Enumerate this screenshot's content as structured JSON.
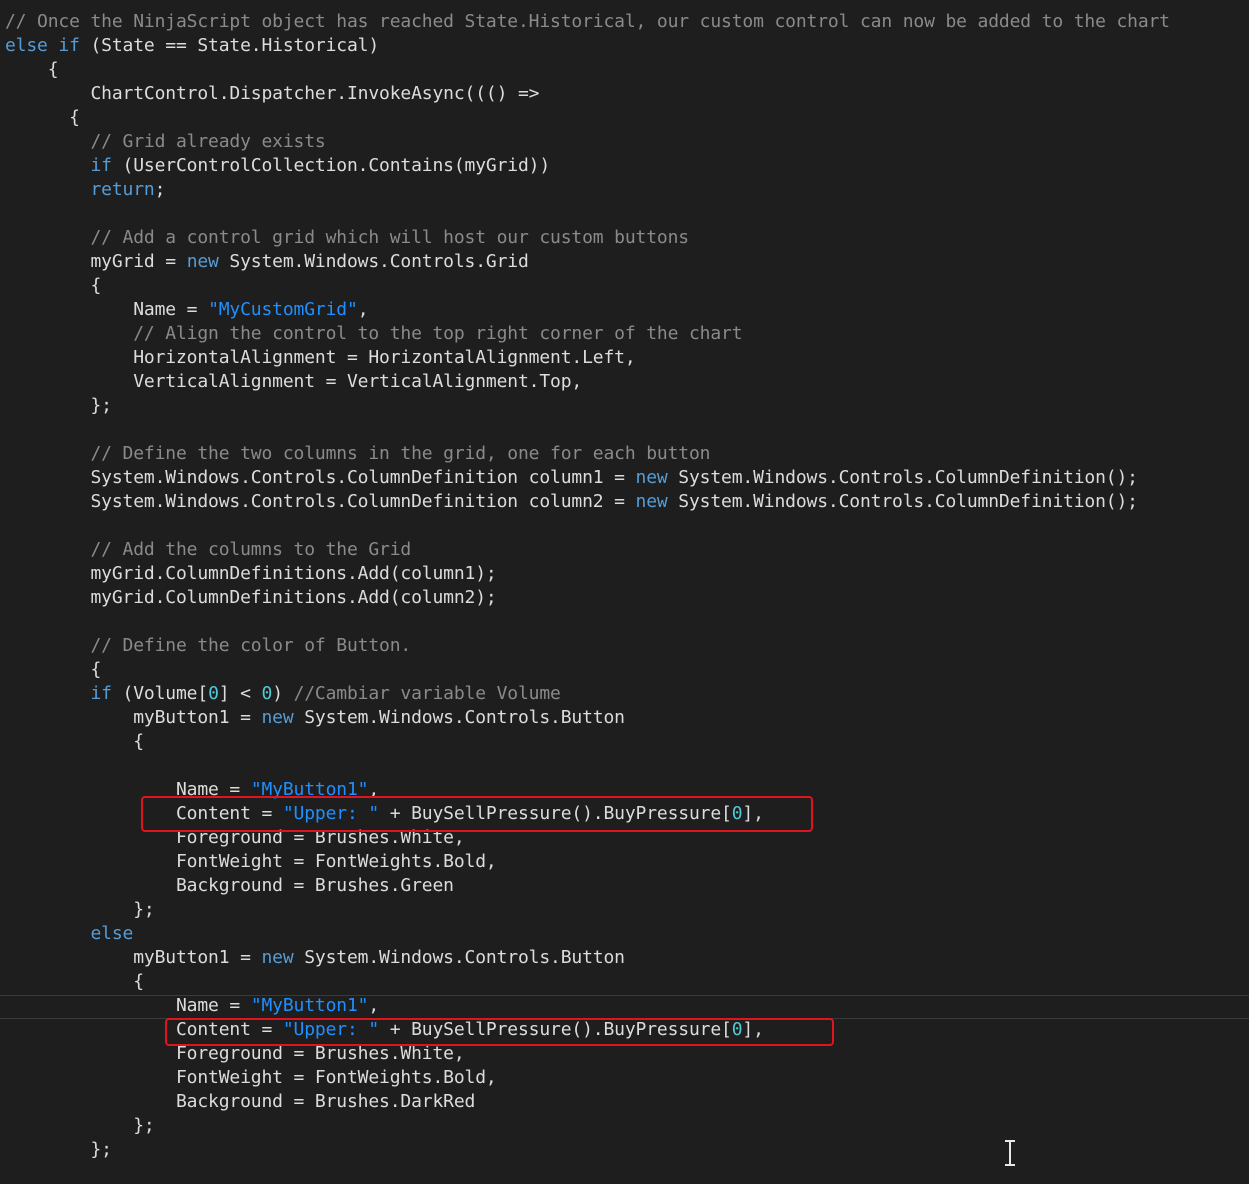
{
  "editor": {
    "lines": [
      [
        {
          "t": "// Once the NinjaScript object has reached State.Historical, our custom control can now be added to the chart",
          "c": "comment"
        }
      ],
      [
        {
          "t": "else if",
          "c": "keyword"
        },
        {
          "t": " (State == State.Historical)",
          "c": "plain"
        }
      ],
      [
        {
          "t": "    {",
          "c": "plain"
        }
      ],
      [
        {
          "t": "        ChartControl.Dispatcher.InvokeAsync((() =>",
          "c": "plain"
        }
      ],
      [
        {
          "t": "      {",
          "c": "plain"
        }
      ],
      [
        {
          "t": "        ",
          "c": "plain"
        },
        {
          "t": "// Grid already exists",
          "c": "comment"
        }
      ],
      [
        {
          "t": "        ",
          "c": "plain"
        },
        {
          "t": "if",
          "c": "keyword"
        },
        {
          "t": " (UserControlCollection.Contains(myGrid))",
          "c": "plain"
        }
      ],
      [
        {
          "t": "        ",
          "c": "plain"
        },
        {
          "t": "return",
          "c": "keyword"
        },
        {
          "t": ";",
          "c": "plain"
        }
      ],
      [],
      [
        {
          "t": "        ",
          "c": "plain"
        },
        {
          "t": "// Add a control grid which will host our custom buttons",
          "c": "comment"
        }
      ],
      [
        {
          "t": "        myGrid = ",
          "c": "plain"
        },
        {
          "t": "new",
          "c": "keyword"
        },
        {
          "t": " System.Windows.Controls.Grid",
          "c": "plain"
        }
      ],
      [
        {
          "t": "        {",
          "c": "plain"
        }
      ],
      [
        {
          "t": "            Name = ",
          "c": "plain"
        },
        {
          "t": "\"MyCustomGrid\"",
          "c": "string"
        },
        {
          "t": ",",
          "c": "plain"
        }
      ],
      [
        {
          "t": "            ",
          "c": "plain"
        },
        {
          "t": "// Align the control to the top right corner of the chart",
          "c": "comment"
        }
      ],
      [
        {
          "t": "            HorizontalAlignment = HorizontalAlignment.Left,",
          "c": "plain"
        }
      ],
      [
        {
          "t": "            VerticalAlignment = VerticalAlignment.Top,",
          "c": "plain"
        }
      ],
      [
        {
          "t": "        };",
          "c": "plain"
        }
      ],
      [],
      [
        {
          "t": "        ",
          "c": "plain"
        },
        {
          "t": "// Define the two columns in the grid, one for each button",
          "c": "comment"
        }
      ],
      [
        {
          "t": "        System.Windows.Controls.ColumnDefinition column1 = ",
          "c": "plain"
        },
        {
          "t": "new",
          "c": "keyword"
        },
        {
          "t": " System.Windows.Controls.ColumnDefinition();",
          "c": "plain"
        }
      ],
      [
        {
          "t": "        System.Windows.Controls.ColumnDefinition column2 = ",
          "c": "plain"
        },
        {
          "t": "new",
          "c": "keyword"
        },
        {
          "t": " System.Windows.Controls.ColumnDefinition();",
          "c": "plain"
        }
      ],
      [],
      [
        {
          "t": "        ",
          "c": "plain"
        },
        {
          "t": "// Add the columns to the Grid",
          "c": "comment"
        }
      ],
      [
        {
          "t": "        myGrid.ColumnDefinitions.Add(column1);",
          "c": "plain"
        }
      ],
      [
        {
          "t": "        myGrid.ColumnDefinitions.Add(column2);",
          "c": "plain"
        }
      ],
      [],
      [
        {
          "t": "        ",
          "c": "plain"
        },
        {
          "t": "// Define the color of Button.",
          "c": "comment"
        }
      ],
      [
        {
          "t": "        {",
          "c": "plain"
        }
      ],
      [
        {
          "t": "        ",
          "c": "plain"
        },
        {
          "t": "if",
          "c": "keyword"
        },
        {
          "t": " (Volume[",
          "c": "plain"
        },
        {
          "t": "0",
          "c": "number"
        },
        {
          "t": "] < ",
          "c": "plain"
        },
        {
          "t": "0",
          "c": "number"
        },
        {
          "t": ") ",
          "c": "plain"
        },
        {
          "t": "//Cambiar variable Volume",
          "c": "comment"
        }
      ],
      [
        {
          "t": "            myButton1 = ",
          "c": "plain"
        },
        {
          "t": "new",
          "c": "keyword"
        },
        {
          "t": " System.Windows.Controls.Button",
          "c": "plain"
        }
      ],
      [
        {
          "t": "            {",
          "c": "plain"
        }
      ],
      [],
      [
        {
          "t": "                Name = ",
          "c": "plain"
        },
        {
          "t": "\"MyButton1\"",
          "c": "string"
        },
        {
          "t": ",",
          "c": "plain"
        }
      ],
      [
        {
          "t": "                Content = ",
          "c": "plain"
        },
        {
          "t": "\"Upper: \"",
          "c": "string"
        },
        {
          "t": " + BuySellPressure().BuyPressure[",
          "c": "plain"
        },
        {
          "t": "0",
          "c": "number"
        },
        {
          "t": "],",
          "c": "plain"
        }
      ],
      [
        {
          "t": "                Foreground = Brushes.White,",
          "c": "plain"
        }
      ],
      [
        {
          "t": "                FontWeight = FontWeights.Bold,",
          "c": "plain"
        }
      ],
      [
        {
          "t": "                Background = Brushes.Green",
          "c": "plain"
        }
      ],
      [
        {
          "t": "            };",
          "c": "plain"
        }
      ],
      [
        {
          "t": "        ",
          "c": "plain"
        },
        {
          "t": "else",
          "c": "keyword"
        }
      ],
      [
        {
          "t": "            myButton1 = ",
          "c": "plain"
        },
        {
          "t": "new",
          "c": "keyword"
        },
        {
          "t": " System.Windows.Controls.Button",
          "c": "plain"
        }
      ],
      [
        {
          "t": "            {",
          "c": "plain"
        }
      ],
      [
        {
          "t": "                Name = ",
          "c": "plain"
        },
        {
          "t": "\"MyButton1\"",
          "c": "string"
        },
        {
          "t": ",",
          "c": "plain"
        }
      ],
      [
        {
          "t": "                Content = ",
          "c": "plain"
        },
        {
          "t": "\"Upper: \"",
          "c": "string"
        },
        {
          "t": " + BuySellPressure().BuyPressure[",
          "c": "plain"
        },
        {
          "t": "0",
          "c": "number"
        },
        {
          "t": "],",
          "c": "plain"
        }
      ],
      [
        {
          "t": "                Foreground = Brushes.White,",
          "c": "plain"
        }
      ],
      [
        {
          "t": "                FontWeight = FontWeights.Bold,",
          "c": "plain"
        }
      ],
      [
        {
          "t": "                Background = Brushes.DarkRed",
          "c": "plain"
        }
      ],
      [
        {
          "t": "            };",
          "c": "plain"
        }
      ],
      [
        {
          "t": "        };",
          "c": "plain"
        }
      ]
    ],
    "colors": {
      "background": "#1e1e1e",
      "plain": "#dcdcdc",
      "comment": "#8a8a8a",
      "keyword": "#569cd6",
      "string": "#1e90ff",
      "number": "#4ec9d6",
      "highlight_box": "#e0141e"
    },
    "highlights": [
      "content-line-if-branch",
      "content-line-else-branch"
    ],
    "cursor_icon": "text-cursor-ibeam-icon"
  }
}
